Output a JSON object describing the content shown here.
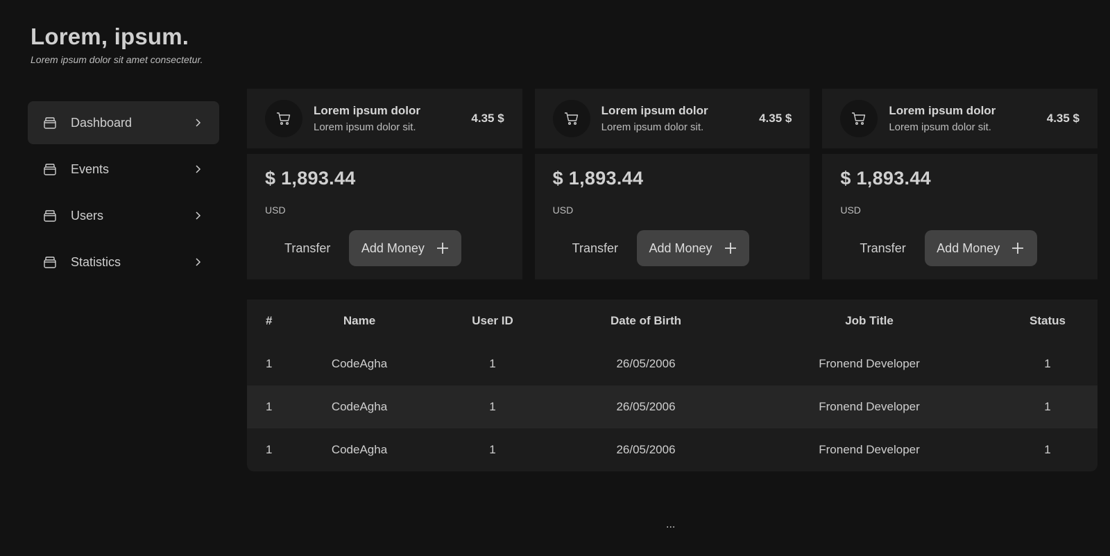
{
  "header": {
    "title": "Lorem, ipsum.",
    "subtitle": "Lorem ipsum dolor sit amet consectetur."
  },
  "sidebar": {
    "items": [
      {
        "label": "Dashboard",
        "icon": "wallet-icon",
        "active": true
      },
      {
        "label": "Events",
        "icon": "wallet-icon",
        "active": false
      },
      {
        "label": "Users",
        "icon": "wallet-icon",
        "active": false
      },
      {
        "label": "Statistics",
        "icon": "wallet-icon",
        "active": false
      }
    ]
  },
  "cards": [
    {
      "title": "Lorem ipsum dolor",
      "subtitle": "Lorem ipsum dolor sit.",
      "price": "4.35 $",
      "amount": "$ 1,893.44",
      "currency": "USD",
      "transfer_label": "Transfer",
      "add_label": "Add Money",
      "icon": "cart-icon"
    },
    {
      "title": "Lorem ipsum dolor",
      "subtitle": "Lorem ipsum dolor sit.",
      "price": "4.35 $",
      "amount": "$ 1,893.44",
      "currency": "USD",
      "transfer_label": "Transfer",
      "add_label": "Add Money",
      "icon": "cart-icon"
    },
    {
      "title": "Lorem ipsum dolor",
      "subtitle": "Lorem ipsum dolor sit.",
      "price": "4.35 $",
      "amount": "$ 1,893.44",
      "currency": "USD",
      "transfer_label": "Transfer",
      "add_label": "Add Money",
      "icon": "cart-icon"
    }
  ],
  "table": {
    "columns": [
      "#",
      "Name",
      "User ID",
      "Date of Birth",
      "Job Title",
      "Status"
    ],
    "rows": [
      [
        "1",
        "CodeAgha",
        "1",
        "26/05/2006",
        "Fronend Developer",
        "1"
      ],
      [
        "1",
        "CodeAgha",
        "1",
        "26/05/2006",
        "Fronend Developer",
        "1"
      ],
      [
        "1",
        "CodeAgha",
        "1",
        "26/05/2006",
        "Fronend Developer",
        "1"
      ]
    ]
  },
  "footer": {
    "more": "..."
  },
  "colors": {
    "background": "#121212",
    "panel": "#1c1c1c",
    "active": "#262626",
    "button": "#424242",
    "text": "#cfcfcf"
  }
}
